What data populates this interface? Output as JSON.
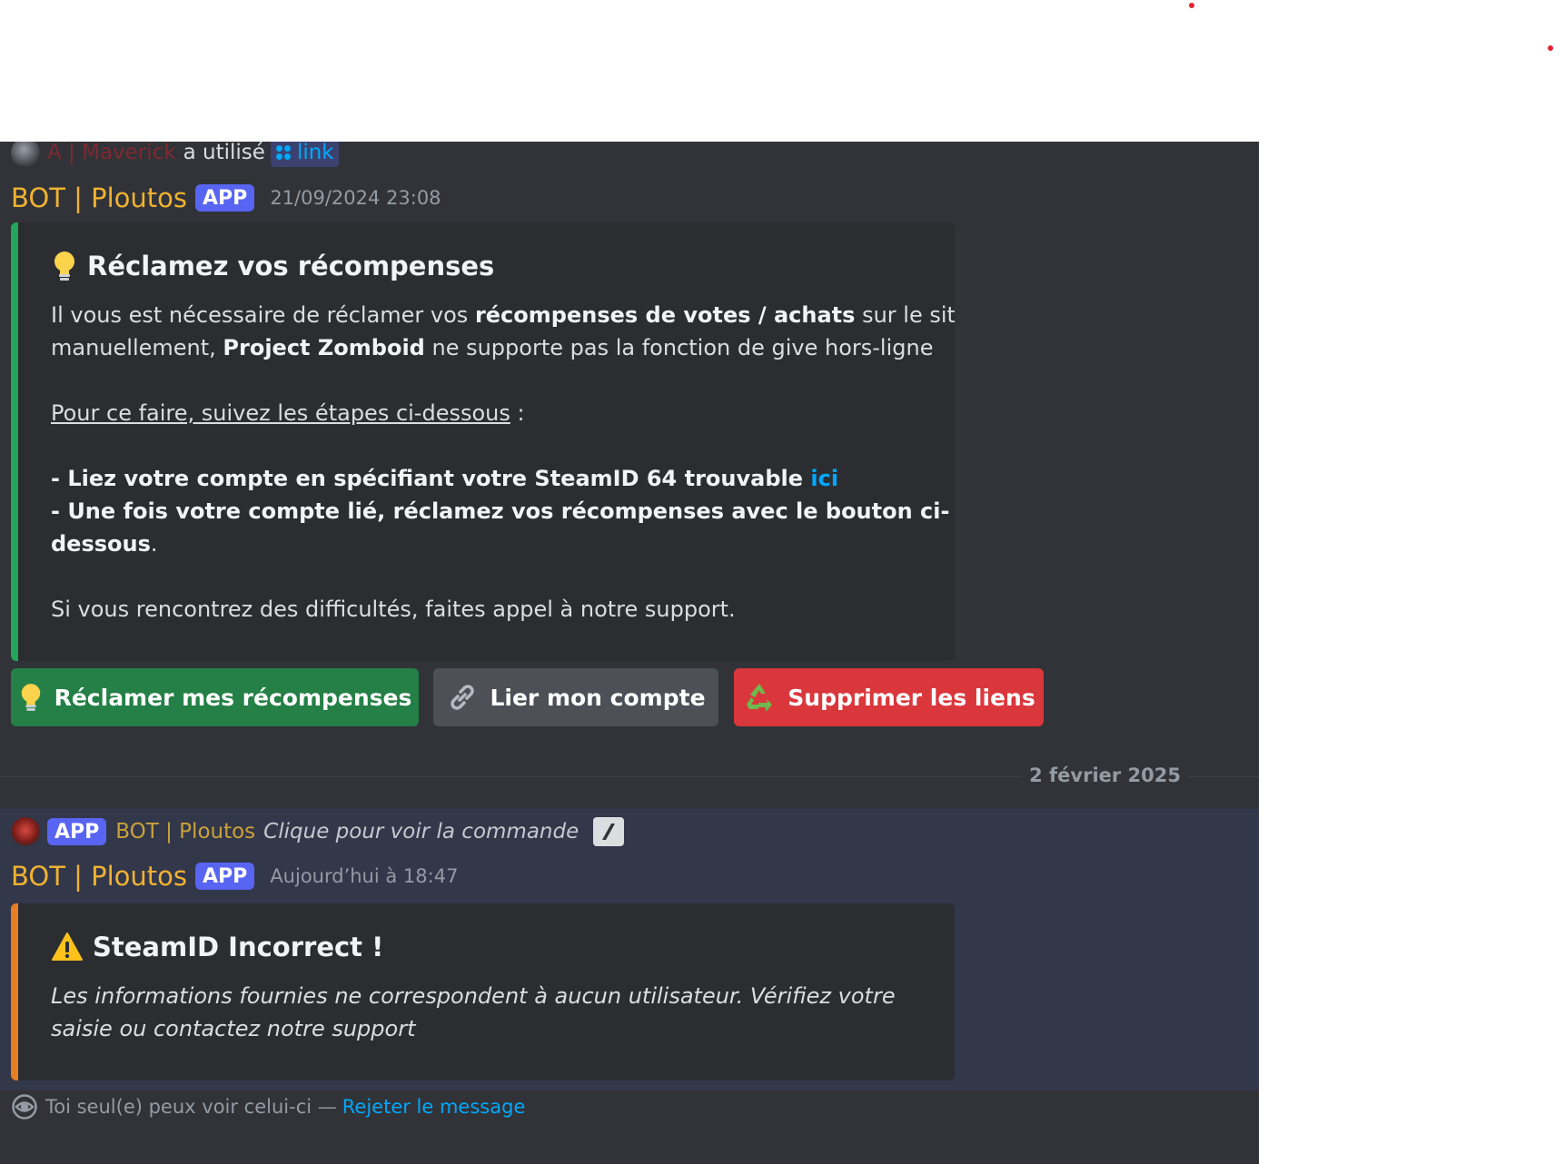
{
  "colors": {
    "background_chat": "#313338",
    "embed_bg": "#2b2d31",
    "bot_name": "#f0b232",
    "badge": "#5865f2",
    "link": "#00a8fc",
    "green_bar": "#23a55a",
    "orange_bar": "#e67e22",
    "button_green": "#248046",
    "button_grey": "#4e5058",
    "button_red": "#da373c"
  },
  "message1": {
    "reply": {
      "avatar_icon": "user-avatar",
      "username": "A | Maverick",
      "action": "a utilisé",
      "command_icon": "slash-command-icon",
      "command": "link"
    },
    "author": {
      "name": "BOT | Ploutos",
      "badge": "APP",
      "timestamp": "21/09/2024 23:08"
    },
    "embed": {
      "title_icon": "lightbulb-icon",
      "title": "Réclamez vos récompenses",
      "p1_part1": "Il vous est nécessaire de réclamer vos ",
      "p1_bold": "récompenses de votes / achats",
      "p1_part2": " sur le site",
      "p1_line2_part1": "manuellement, ",
      "p1_line2_bold": "Project Zomboid",
      "p1_line2_part2": " ne supporte pas la fonction de give hors-ligne",
      "steps_heading": "Pour ce faire, suivez les étapes ci-dessous",
      "steps_colon": " :",
      "step1": "- Liez votre compte en spécifiant votre SteamID 64 trouvable ",
      "step1_link": "ici",
      "step2_line1": "- Une fois votre compte lié, réclamez vos récompenses avec le bouton ci-",
      "step2_line2": "dessous",
      "step2_period": ".",
      "footer": "Si vous rencontrez des difficultés, faites appel à notre support."
    },
    "buttons": [
      {
        "icon": "lightbulb-icon",
        "label": "Réclamer mes récompenses"
      },
      {
        "icon": "link-icon",
        "label": "Lier mon compte"
      },
      {
        "icon": "recycle-icon",
        "label": "Supprimer les liens"
      }
    ]
  },
  "divider": {
    "date": "2 février 2025"
  },
  "message2": {
    "reply": {
      "avatar_icon": "bot-avatar",
      "badge": "APP",
      "username": "BOT | Ploutos",
      "action": "Clique pour voir la commande",
      "command_icon": "slash-command-icon"
    },
    "author": {
      "name": "BOT | Ploutos",
      "badge": "APP",
      "timestamp": "Aujourd’hui à 18:47"
    },
    "embed": {
      "title_icon": "warning-icon",
      "title": "SteamID Incorrect !",
      "line1": "Les informations fournies ne correspondent à aucun utilisateur. Vérifiez votre",
      "line2": "saisie ou contactez notre support"
    },
    "ephemeral": {
      "icon": "eye-icon",
      "text": "Toi seul(e) peux voir celui-ci — ",
      "dismiss": "Rejeter le message"
    }
  }
}
